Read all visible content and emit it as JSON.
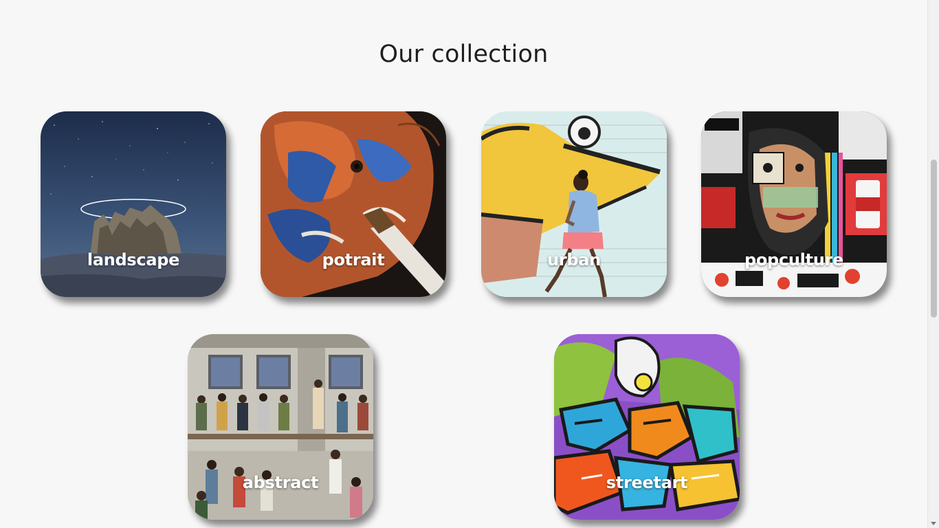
{
  "page": {
    "title": "Our collection"
  },
  "collection": [
    {
      "label": "landscape"
    },
    {
      "label": "potrait"
    },
    {
      "label": "urban"
    },
    {
      "label": "popculture"
    },
    {
      "label": "abstract"
    },
    {
      "label": "streetart"
    }
  ],
  "colors": {
    "background": "#f7f7f7",
    "heading": "#1f1f1f",
    "card_label": "#ffffff"
  }
}
